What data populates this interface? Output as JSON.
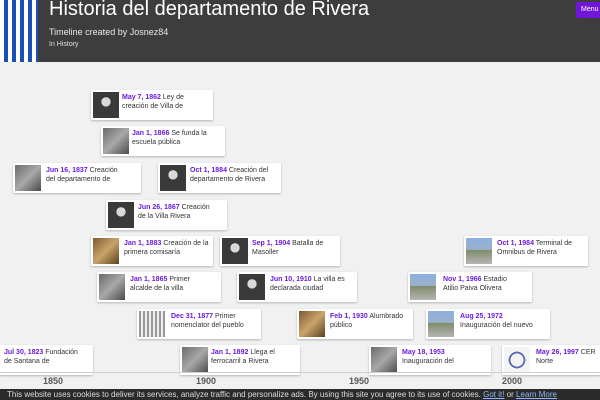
{
  "header": {
    "title": "Historia del departamento de Rivera",
    "subtitle": "Timeline created by Josnez84",
    "category": "In History",
    "menu_label": "Menu"
  },
  "events": [
    {
      "date": "May 7, 1862",
      "line1": "Ley de",
      "line2": "creación de Villa de",
      "thumb": "portrait"
    },
    {
      "date": "Jan 1, 1866",
      "line1": "Se funda la",
      "line2": "escuela pública",
      "thumb": "photo"
    },
    {
      "date": "Jun 16, 1837",
      "line1": "Creación",
      "line2": "del departamento de",
      "thumb": "photo"
    },
    {
      "date": "Oct 1, 1884",
      "line1": "Creación del",
      "line2": "departamento de Rivera",
      "thumb": "portrait"
    },
    {
      "date": "Jun 26, 1867",
      "line1": "Creación",
      "line2": "de la Villa Rivera",
      "thumb": "portrait"
    },
    {
      "date": "Jan 1, 1883",
      "line1": "Creación de la",
      "line2": "primera comisaría",
      "thumb": "sepia"
    },
    {
      "date": "Sep 1, 1904",
      "line1": "Batalla de",
      "line2": "Masoller",
      "thumb": "portrait"
    },
    {
      "date": "Oct 1, 1984",
      "line1": "Terminal de",
      "line2": "Omnibus de Rivera",
      "thumb": "color"
    },
    {
      "date": "Jan 1, 1865",
      "line1": "Primer",
      "line2": "alcalde de la villa",
      "thumb": "photo"
    },
    {
      "date": "Jun 10, 1910",
      "line1": "La villa es",
      "line2": "declarada ciudad",
      "thumb": "portrait"
    },
    {
      "date": "Nov 1, 1966",
      "line1": "Estadio",
      "line2": "Atilio Paiva Olivera",
      "thumb": "color"
    },
    {
      "date": "Dec 31, 1877",
      "line1": "Primer",
      "line2": "nomenclator del pueblo",
      "thumb": "grid"
    },
    {
      "date": "Feb 1, 1930",
      "line1": "Alumbrado",
      "line2": "público",
      "thumb": "sepia"
    },
    {
      "date": "Aug 25, 1972",
      "line1": "",
      "line2": "Inauguración del nuevo",
      "thumb": "color"
    },
    {
      "date": "Jul 30, 1823",
      "line1": "Fundación",
      "line2": "de Santana de",
      "thumb": "none"
    },
    {
      "date": "Jan 1, 1892",
      "line1": "Llega el",
      "line2": "ferrocarril a Rivera",
      "thumb": "photo"
    },
    {
      "date": "May 18, 1953",
      "line1": "",
      "line2": "Inauguración del",
      "thumb": "photo"
    },
    {
      "date": "May 26, 1997",
      "line1": "CER",
      "line2": "Norte",
      "thumb": "seal"
    }
  ],
  "axis": {
    "ticks": [
      "1850",
      "1900",
      "1950",
      "2000"
    ]
  },
  "cookie": {
    "text": "This website uses cookies to deliver its services, analyze traffic and personalize ads. By using this site you agree to its use of cookies.",
    "got_it": "Got it!",
    "or": "or",
    "learn_more": "Learn More"
  }
}
